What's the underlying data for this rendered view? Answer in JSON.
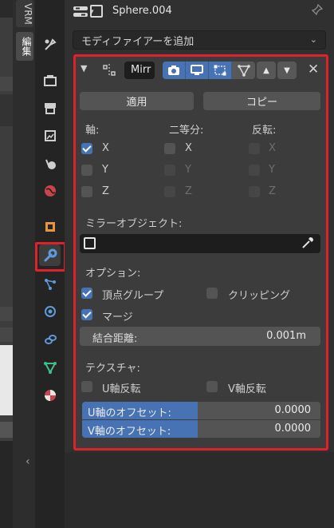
{
  "app": {
    "object_name": "Sphere.004",
    "vertical_tabs": [
      "VRM",
      "編集"
    ]
  },
  "toolbar": {
    "add_modifier_label": "モディファイアーを追加"
  },
  "tabs": [
    {
      "name": "tool",
      "icon": "tool-icon"
    },
    {
      "name": "render",
      "icon": "render-icon"
    },
    {
      "name": "output",
      "icon": "output-icon"
    },
    {
      "name": "view-layer",
      "icon": "view-layer-icon"
    },
    {
      "name": "scene",
      "icon": "scene-icon"
    },
    {
      "name": "world",
      "icon": "world-icon"
    },
    {
      "name": "object",
      "icon": "object-icon"
    },
    {
      "name": "modifier",
      "icon": "wrench-icon",
      "active": true
    },
    {
      "name": "particles",
      "icon": "particles-icon"
    },
    {
      "name": "physics",
      "icon": "physics-icon"
    },
    {
      "name": "constraints",
      "icon": "constraints-icon"
    },
    {
      "name": "data",
      "icon": "mesh-data-icon"
    },
    {
      "name": "material",
      "icon": "material-icon"
    }
  ],
  "modifier": {
    "name": "Mirr",
    "apply_label": "適用",
    "copy_label": "コピー",
    "axis_header": "軸:",
    "bisect_header": "二等分:",
    "flip_header": "反転:",
    "axes": [
      "X",
      "Y",
      "Z"
    ],
    "axis_checked": [
      true,
      false,
      false
    ],
    "mirror_object_label": "ミラーオブジェクト:",
    "options_label": "オプション:",
    "vertex_groups_label": "頂点グループ",
    "vertex_groups_checked": true,
    "clipping_label": "クリッピング",
    "clipping_checked": false,
    "merge_label": "マージ",
    "merge_checked": true,
    "merge_distance_label": "結合距離:",
    "merge_distance_value": "0.001m",
    "textures_label": "テクスチャ:",
    "flip_u_label": "U軸反転",
    "flip_v_label": "V軸反転",
    "u_offset_label": "U軸のオフセット:",
    "u_offset_value": "0.0000",
    "v_offset_label": "V軸のオフセット:",
    "v_offset_value": "0.0000"
  },
  "colors": {
    "accent": "#4772b3",
    "highlight": "#e0202a"
  }
}
